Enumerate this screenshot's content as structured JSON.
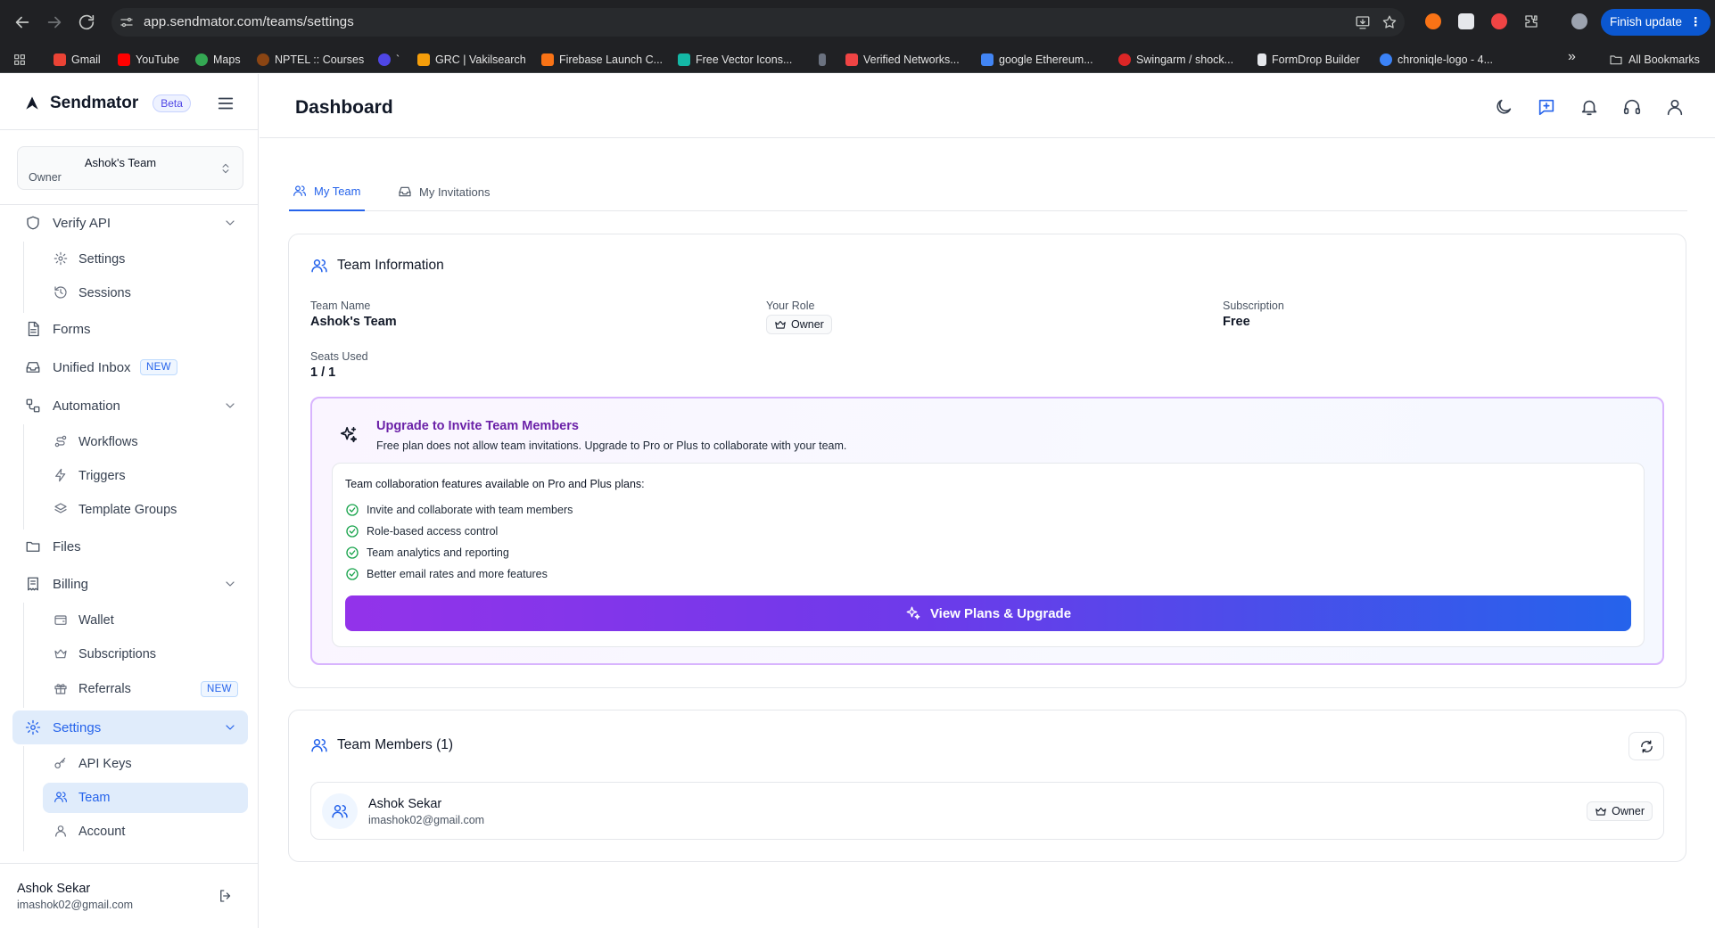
{
  "browser": {
    "url": "app.sendmator.com/teams/settings",
    "finish_update": "Finish update",
    "finish_dots": "⋮",
    "bookmarks": [
      {
        "label": "Gmail",
        "color": "#ea4335"
      },
      {
        "label": "YouTube",
        "color": "#ff0000"
      },
      {
        "label": "Maps",
        "color": "#34a853"
      },
      {
        "label": "NPTEL :: Courses",
        "color": "#8b4513"
      },
      {
        "label": "`",
        "color": "#4f46e5"
      },
      {
        "label": "GRC | Vakilsearch",
        "color": "#f59e0b"
      },
      {
        "label": "Firebase Launch C...",
        "color": "#f97316"
      },
      {
        "label": "Free Vector Icons...",
        "color": "#14b8a6"
      },
      {
        "label": "",
        "color": "#6b7280"
      },
      {
        "label": "Verified Networks...",
        "color": "#ef4444"
      },
      {
        "label": "google Ethereum...",
        "color": "#4285f4"
      },
      {
        "label": "Swingarm / shock...",
        "color": "#dc2626"
      },
      {
        "label": "FormDrop Builder",
        "color": "#e5e7eb"
      },
      {
        "label": "chroniqle-logo - 4...",
        "color": "#3b82f6"
      }
    ],
    "more_bookmarks": "»",
    "all_bookmarks": "All Bookmarks"
  },
  "sidebar": {
    "brand": "Sendmator",
    "beta": "Beta",
    "team_select": {
      "name": "Ashok's Team",
      "role": "Owner"
    },
    "nav": {
      "verify_api": "Verify API",
      "settings_sub": "Settings",
      "sessions": "Sessions",
      "forms": "Forms",
      "unified_inbox": "Unified Inbox",
      "automation": "Automation",
      "workflows": "Workflows",
      "triggers": "Triggers",
      "template_groups": "Template Groups",
      "files": "Files",
      "billing": "Billing",
      "wallet": "Wallet",
      "subscriptions": "Subscriptions",
      "referrals": "Referrals",
      "settings": "Settings",
      "api_keys": "API Keys",
      "team": "Team",
      "account": "Account"
    },
    "new_badge": "NEW",
    "user": {
      "name": "Ashok Sekar",
      "email": "imashok02@gmail.com"
    }
  },
  "header": {
    "title": "Dashboard"
  },
  "tabs": {
    "my_team": "My Team",
    "my_invitations": "My Invitations"
  },
  "team_info": {
    "title": "Team Information",
    "team_name_label": "Team Name",
    "team_name": "Ashok's Team",
    "role_label": "Your Role",
    "role": "Owner",
    "subscription_label": "Subscription",
    "subscription": "Free",
    "seats_label": "Seats Used",
    "seats": "1 / 1"
  },
  "upgrade": {
    "title": "Upgrade to Invite Team Members",
    "description": "Free plan does not allow team invitations. Upgrade to Pro or Plus to collaborate with your team.",
    "features_title": "Team collaboration features available on Pro and Plus plans:",
    "features": [
      "Invite and collaborate with team members",
      "Role-based access control",
      "Team analytics and reporting",
      "Better email rates and more features"
    ],
    "cta": "View Plans & Upgrade"
  },
  "members": {
    "title": "Team Members (1)",
    "list": [
      {
        "name": "Ashok Sekar",
        "email": "imashok02@gmail.com",
        "role": "Owner"
      }
    ]
  }
}
